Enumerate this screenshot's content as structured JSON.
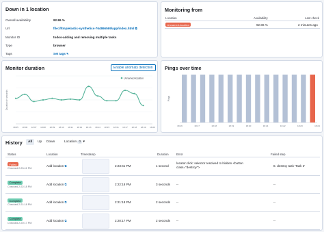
{
  "summary": {
    "title": "Down in 1 location",
    "rows": [
      {
        "label": "Overall availability",
        "value": "92.86 %"
      },
      {
        "label": "Url",
        "value": "file:///tmp/elastic-synthetics-764866569/app/index.html"
      },
      {
        "label": "Monitor ID",
        "value": "todos-adding and removing multiple tasks"
      },
      {
        "label": "Type",
        "value": "browser"
      },
      {
        "label": "Tags",
        "value": "Set tags"
      }
    ]
  },
  "monitoring_from": {
    "title": "Monitoring from",
    "columns": [
      "Location",
      "Availability",
      "Last check"
    ],
    "row": {
      "location": "Unnamed-location",
      "availability": "92.86 %",
      "last_check": "2 minutes ago"
    }
  },
  "duration": {
    "title": "Monitor duration",
    "button": "Enable anomaly detection",
    "legend": "Unnamed-location",
    "ylabel": "Duration in seconds"
  },
  "pings": {
    "title": "Pings over time",
    "ylabel": "Pings"
  },
  "chart_data": [
    {
      "type": "line",
      "title": "Monitor duration",
      "ylabel": "Duration in seconds",
      "x": [
        "18:05",
        "18:06",
        "18:07",
        "18:08",
        "18:09",
        "18:10",
        "18:11",
        "18:12",
        "18:13",
        "18:14",
        "18:15",
        "18:16",
        "18:17",
        "18:18",
        "18:19",
        "18:20"
      ],
      "series": [
        {
          "name": "Unnamed-location",
          "color": "#54b399",
          "values": [
            3.2,
            3.7,
            2.8,
            3.0,
            3.2,
            3.0,
            3.1,
            3.0,
            4.7,
            3.5,
            2.9,
            2.9,
            4.2,
            3.8,
            2.3,
            null
          ]
        }
      ],
      "ylim": [
        0,
        6
      ]
    },
    {
      "type": "bar",
      "title": "Pings over time",
      "ylabel": "Pings",
      "categories": [
        "18:16",
        "18:17",
        "18:18",
        "18:19",
        "18:20",
        "18:21",
        "18:22",
        "18:23",
        "18:24"
      ],
      "series": [
        {
          "name": "up",
          "color": "#b4c1d6",
          "values": [
            1,
            1,
            1,
            1,
            1,
            1,
            1,
            1,
            1,
            1,
            1,
            1,
            1,
            1,
            0
          ]
        },
        {
          "name": "down",
          "color": "#e7664c",
          "values": [
            0,
            0,
            0,
            0,
            0,
            0,
            0,
            0,
            0,
            0,
            0,
            0,
            0,
            0,
            1
          ]
        }
      ]
    }
  ],
  "history": {
    "title": "History",
    "filters": [
      "All",
      "Up",
      "Down"
    ],
    "location_filter": "Location",
    "location_count": "0",
    "columns": [
      "Status",
      "Location",
      "Timestamp",
      "Duration",
      "Error",
      "Failed step"
    ],
    "rows": [
      {
        "status": "Failed",
        "checked": "Checked 2:23:41 PM",
        "location": "Add location",
        "timestamp": "2:23:41 PM",
        "duration": "1 second",
        "error": "locator.click: selector resolved to hidden <button class=\"destroy\">",
        "failed_step": "8. destroy task 'Task 2'"
      },
      {
        "status": "Complete",
        "checked": "Checked 2:22:18 PM",
        "location": "Add location",
        "timestamp": "2:22:18 PM",
        "duration": "3 seconds",
        "error": "--",
        "failed_step": "--"
      },
      {
        "status": "Complete",
        "checked": "Checked 2:21:18 PM",
        "location": "Add location",
        "timestamp": "2:21:18 PM",
        "duration": "2 seconds",
        "error": "--",
        "failed_step": "--"
      },
      {
        "status": "Complete",
        "checked": "Checked 2:20:17 PM",
        "location": "Add location",
        "timestamp": "2:20:17 PM",
        "duration": "2 seconds",
        "error": "--",
        "failed_step": "--"
      }
    ]
  }
}
